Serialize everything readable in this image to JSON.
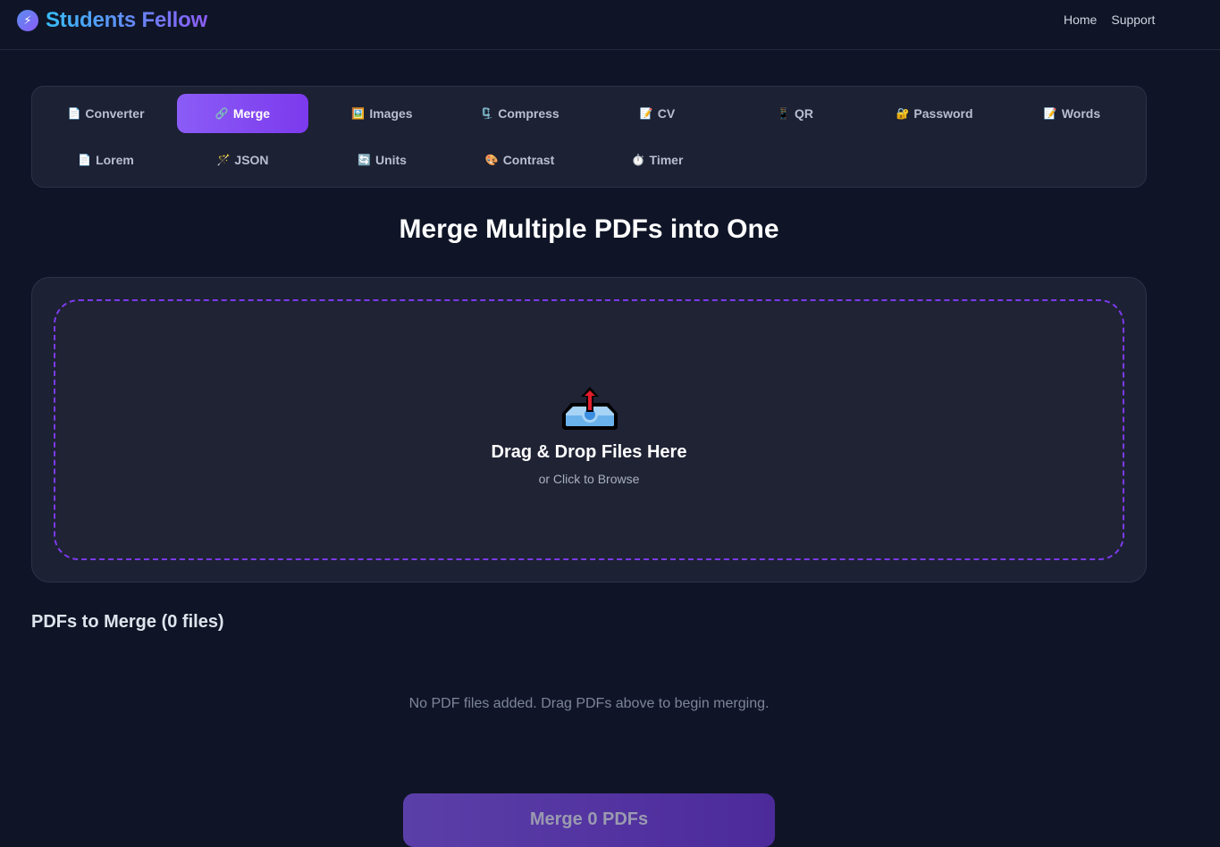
{
  "brand": {
    "icon": "⚡",
    "name": "Students Fellow"
  },
  "top_nav": {
    "home": "Home",
    "support": "Support"
  },
  "tools": [
    {
      "icon": "📄",
      "label": "Converter"
    },
    {
      "icon": "🔗",
      "label": "Merge",
      "active": true
    },
    {
      "icon": "🖼️",
      "label": "Images"
    },
    {
      "icon": "🗜️",
      "label": "Compress"
    },
    {
      "icon": "📝",
      "label": "CV"
    },
    {
      "icon": "📱",
      "label": "QR"
    },
    {
      "icon": "🔐",
      "label": "Password"
    },
    {
      "icon": "📝",
      "label": "Words"
    },
    {
      "icon": "📄",
      "label": "Lorem"
    },
    {
      "icon": "🪄",
      "label": "JSON"
    },
    {
      "icon": "🔄",
      "label": "Units"
    },
    {
      "icon": "🎨",
      "label": "Contrast"
    },
    {
      "icon": "⏱️",
      "label": "Timer"
    }
  ],
  "main": {
    "title": "Merge Multiple PDFs into One",
    "drop_title": "Drag & Drop Files Here",
    "drop_subtitle": "or Click to Browse",
    "list_title": "PDFs to Merge (0 files)",
    "empty_message": "No PDF files added. Drag PDFs above to begin merging.",
    "merge_button": "Merge 0 PDFs"
  },
  "colors": {
    "background": "#0f1527",
    "card": "#1c2133",
    "accent": "#8b5cf6"
  }
}
